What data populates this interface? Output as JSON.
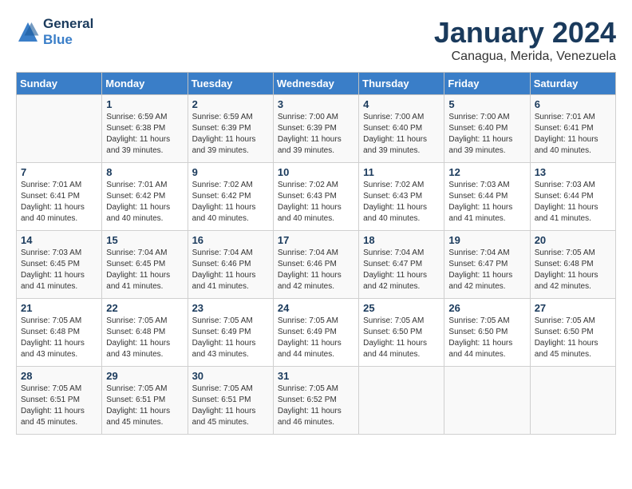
{
  "header": {
    "logo_line1": "General",
    "logo_line2": "Blue",
    "title": "January 2024",
    "subtitle": "Canagua, Merida, Venezuela"
  },
  "weekdays": [
    "Sunday",
    "Monday",
    "Tuesday",
    "Wednesday",
    "Thursday",
    "Friday",
    "Saturday"
  ],
  "weeks": [
    [
      {
        "day": "",
        "info": ""
      },
      {
        "day": "1",
        "info": "Sunrise: 6:59 AM\nSunset: 6:38 PM\nDaylight: 11 hours\nand 39 minutes."
      },
      {
        "day": "2",
        "info": "Sunrise: 6:59 AM\nSunset: 6:39 PM\nDaylight: 11 hours\nand 39 minutes."
      },
      {
        "day": "3",
        "info": "Sunrise: 7:00 AM\nSunset: 6:39 PM\nDaylight: 11 hours\nand 39 minutes."
      },
      {
        "day": "4",
        "info": "Sunrise: 7:00 AM\nSunset: 6:40 PM\nDaylight: 11 hours\nand 39 minutes."
      },
      {
        "day": "5",
        "info": "Sunrise: 7:00 AM\nSunset: 6:40 PM\nDaylight: 11 hours\nand 39 minutes."
      },
      {
        "day": "6",
        "info": "Sunrise: 7:01 AM\nSunset: 6:41 PM\nDaylight: 11 hours\nand 40 minutes."
      }
    ],
    [
      {
        "day": "7",
        "info": "Sunrise: 7:01 AM\nSunset: 6:41 PM\nDaylight: 11 hours\nand 40 minutes."
      },
      {
        "day": "8",
        "info": "Sunrise: 7:01 AM\nSunset: 6:42 PM\nDaylight: 11 hours\nand 40 minutes."
      },
      {
        "day": "9",
        "info": "Sunrise: 7:02 AM\nSunset: 6:42 PM\nDaylight: 11 hours\nand 40 minutes."
      },
      {
        "day": "10",
        "info": "Sunrise: 7:02 AM\nSunset: 6:43 PM\nDaylight: 11 hours\nand 40 minutes."
      },
      {
        "day": "11",
        "info": "Sunrise: 7:02 AM\nSunset: 6:43 PM\nDaylight: 11 hours\nand 40 minutes."
      },
      {
        "day": "12",
        "info": "Sunrise: 7:03 AM\nSunset: 6:44 PM\nDaylight: 11 hours\nand 41 minutes."
      },
      {
        "day": "13",
        "info": "Sunrise: 7:03 AM\nSunset: 6:44 PM\nDaylight: 11 hours\nand 41 minutes."
      }
    ],
    [
      {
        "day": "14",
        "info": "Sunrise: 7:03 AM\nSunset: 6:45 PM\nDaylight: 11 hours\nand 41 minutes."
      },
      {
        "day": "15",
        "info": "Sunrise: 7:04 AM\nSunset: 6:45 PM\nDaylight: 11 hours\nand 41 minutes."
      },
      {
        "day": "16",
        "info": "Sunrise: 7:04 AM\nSunset: 6:46 PM\nDaylight: 11 hours\nand 41 minutes."
      },
      {
        "day": "17",
        "info": "Sunrise: 7:04 AM\nSunset: 6:46 PM\nDaylight: 11 hours\nand 42 minutes."
      },
      {
        "day": "18",
        "info": "Sunrise: 7:04 AM\nSunset: 6:47 PM\nDaylight: 11 hours\nand 42 minutes."
      },
      {
        "day": "19",
        "info": "Sunrise: 7:04 AM\nSunset: 6:47 PM\nDaylight: 11 hours\nand 42 minutes."
      },
      {
        "day": "20",
        "info": "Sunrise: 7:05 AM\nSunset: 6:48 PM\nDaylight: 11 hours\nand 42 minutes."
      }
    ],
    [
      {
        "day": "21",
        "info": "Sunrise: 7:05 AM\nSunset: 6:48 PM\nDaylight: 11 hours\nand 43 minutes."
      },
      {
        "day": "22",
        "info": "Sunrise: 7:05 AM\nSunset: 6:48 PM\nDaylight: 11 hours\nand 43 minutes."
      },
      {
        "day": "23",
        "info": "Sunrise: 7:05 AM\nSunset: 6:49 PM\nDaylight: 11 hours\nand 43 minutes."
      },
      {
        "day": "24",
        "info": "Sunrise: 7:05 AM\nSunset: 6:49 PM\nDaylight: 11 hours\nand 44 minutes."
      },
      {
        "day": "25",
        "info": "Sunrise: 7:05 AM\nSunset: 6:50 PM\nDaylight: 11 hours\nand 44 minutes."
      },
      {
        "day": "26",
        "info": "Sunrise: 7:05 AM\nSunset: 6:50 PM\nDaylight: 11 hours\nand 44 minutes."
      },
      {
        "day": "27",
        "info": "Sunrise: 7:05 AM\nSunset: 6:50 PM\nDaylight: 11 hours\nand 45 minutes."
      }
    ],
    [
      {
        "day": "28",
        "info": "Sunrise: 7:05 AM\nSunset: 6:51 PM\nDaylight: 11 hours\nand 45 minutes."
      },
      {
        "day": "29",
        "info": "Sunrise: 7:05 AM\nSunset: 6:51 PM\nDaylight: 11 hours\nand 45 minutes."
      },
      {
        "day": "30",
        "info": "Sunrise: 7:05 AM\nSunset: 6:51 PM\nDaylight: 11 hours\nand 45 minutes."
      },
      {
        "day": "31",
        "info": "Sunrise: 7:05 AM\nSunset: 6:52 PM\nDaylight: 11 hours\nand 46 minutes."
      },
      {
        "day": "",
        "info": ""
      },
      {
        "day": "",
        "info": ""
      },
      {
        "day": "",
        "info": ""
      }
    ]
  ]
}
